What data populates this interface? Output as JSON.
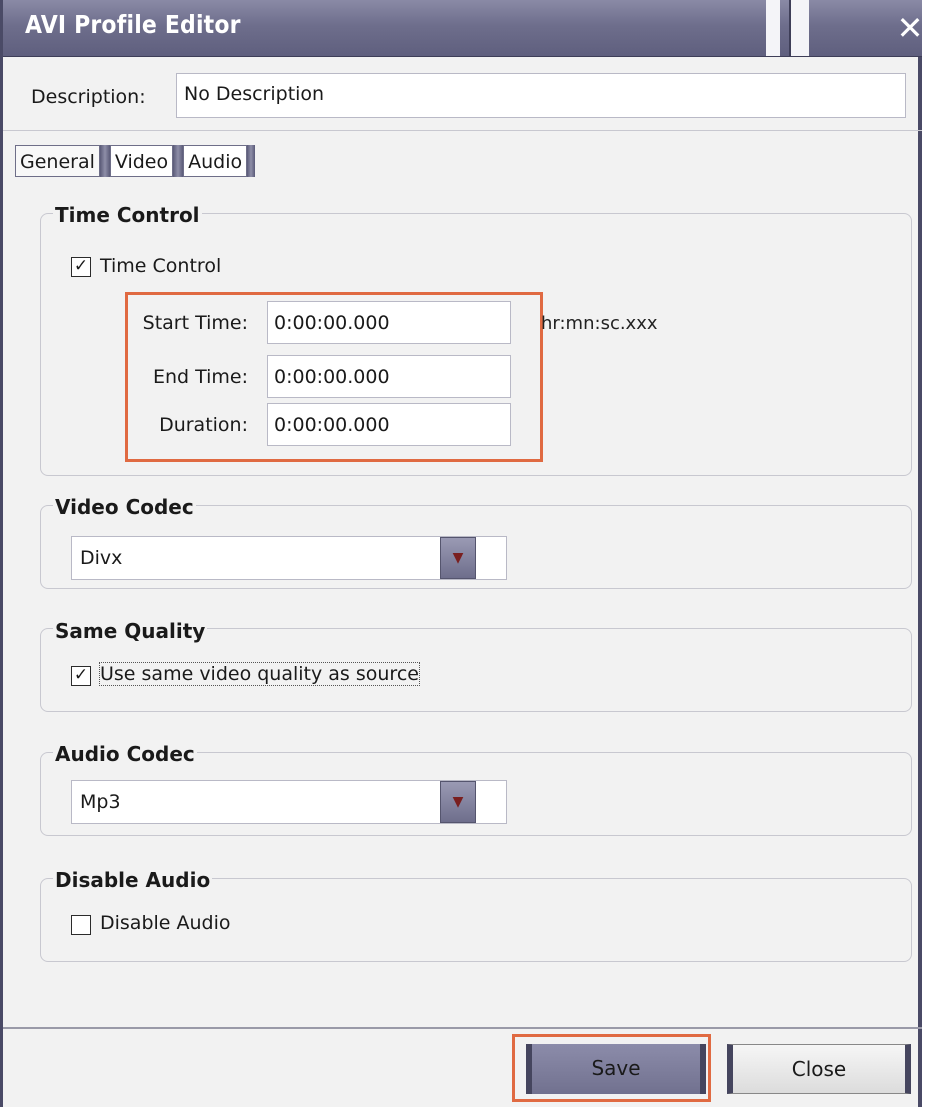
{
  "window": {
    "title": "AVI Profile Editor"
  },
  "description": {
    "label": "Description:",
    "value": "No Description"
  },
  "tabs": [
    {
      "label": "General",
      "active": true
    },
    {
      "label": "Video",
      "active": false
    },
    {
      "label": "Audio",
      "active": false
    }
  ],
  "time_control": {
    "group_title": "Time Control",
    "checkbox_label": "Time Control",
    "checked": true,
    "start_label": "Start Time:",
    "start_value": "0:00:00.000",
    "end_label": "End Time:",
    "end_value": "0:00:00.000",
    "duration_label": "Duration:",
    "duration_value": "0:00:00.000",
    "format_hint": "hr:mn:sc.xxx"
  },
  "video_codec": {
    "group_title": "Video Codec",
    "selected": "Divx"
  },
  "same_quality": {
    "group_title": "Same Quality",
    "checkbox_label": "Use same video quality as source",
    "checked": true
  },
  "audio_codec": {
    "group_title": "Audio Codec",
    "selected": "Mp3"
  },
  "disable_audio": {
    "group_title": "Disable Audio",
    "checkbox_label": "Disable Audio",
    "checked": false
  },
  "footer": {
    "save_label": "Save",
    "close_label": "Close"
  },
  "colors": {
    "titlebar": "#6e6e8c",
    "highlight": "#e06a42",
    "accent": "#45455e"
  },
  "icons": {
    "close": "close-icon",
    "dropdown": "chevron-down-icon",
    "check": "checkmark-icon"
  }
}
